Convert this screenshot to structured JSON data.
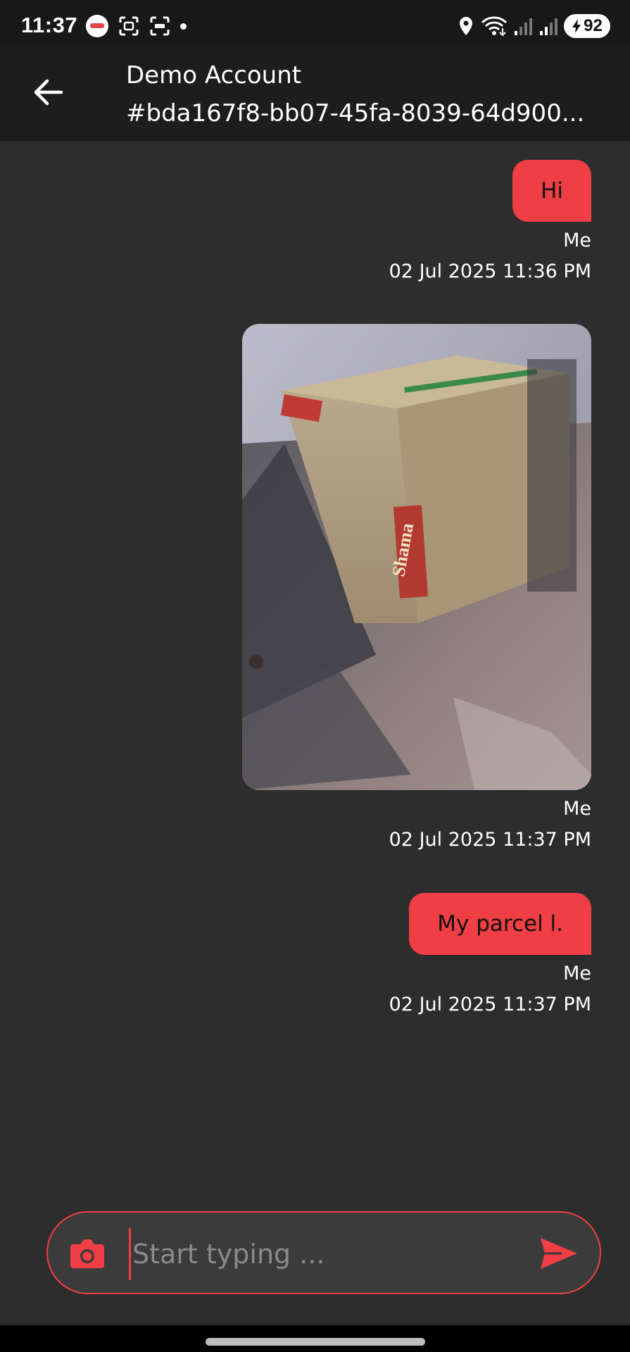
{
  "status_bar": {
    "time": "11:37",
    "battery": "92",
    "icons": [
      "app-badge-icon",
      "screen-capture-icon",
      "screenshot-icon",
      "location-icon",
      "wifi-icon",
      "signal-icon",
      "signal-icon",
      "charging-icon"
    ]
  },
  "header": {
    "name": "Demo Account",
    "subtitle": "#bda167f8-bb07-45fa-8039-64d900..."
  },
  "messages": [
    {
      "type": "text",
      "text": "Hi",
      "sender": "Me",
      "timestamp": "02 Jul 2025 11:36 PM"
    },
    {
      "type": "image",
      "description_icon": "photo",
      "sender": "Me",
      "timestamp": "02 Jul 2025 11:37 PM"
    },
    {
      "type": "text",
      "text": "My parcel l.",
      "sender": "Me",
      "timestamp": "02 Jul 2025 11:37 PM"
    }
  ],
  "composer": {
    "placeholder": "Start typing ...",
    "value": ""
  },
  "colors": {
    "accent": "#ef3e44",
    "background": "#2d2d2d",
    "appbar": "#1d1d1d"
  }
}
